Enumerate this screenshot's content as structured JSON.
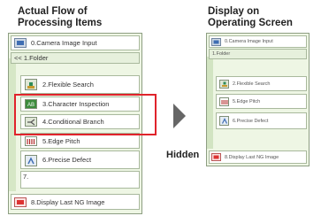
{
  "left_title": [
    "Actual Flow of",
    "Processing Items"
  ],
  "right_title": [
    "Display on",
    "Operating Screen"
  ],
  "hidden_label": "Hidden",
  "actual_flow": {
    "camera_input": "0.Camera Image Input",
    "folder": "<< 1.Folder",
    "flexible_search": "2.Flexible Search",
    "character_inspection": "3.Character Inspection",
    "conditional_branch": "4.Conditional Branch",
    "edge_pitch": "5.Edge Pitch",
    "precise_defect": "6.Precise Defect",
    "empty_item": "7.",
    "display_last_ng": "8.Display Last NG Image"
  },
  "operating_screen": {
    "camera_input": "0.Camera Image Input",
    "folder": "1.Folder",
    "flexible_search": "2.Flexible Search",
    "edge_pitch": "5.Edge Pitch",
    "precise_defect": "6.Precise Defect",
    "display_last_ng": "8.Display Last NG Image"
  },
  "colors": {
    "panel_bg": "#eef6e4",
    "highlight": "#e0232b",
    "arrow": "#666666"
  }
}
